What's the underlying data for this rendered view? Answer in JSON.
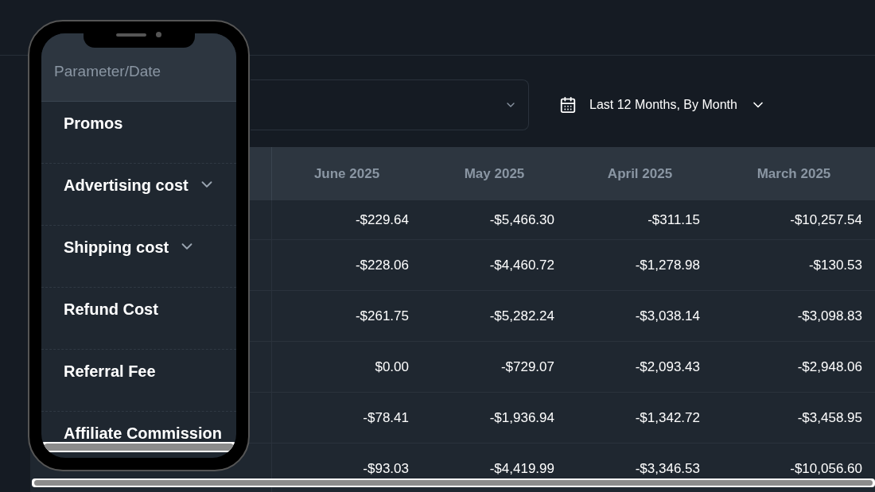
{
  "toolbar": {
    "date_range": {
      "label": "Last 12 Months, By Month"
    }
  },
  "table": {
    "columns": [
      "June 2025",
      "May 2025",
      "April 2025",
      "March 2025"
    ],
    "rows": [
      {
        "values": [
          "-$229.64",
          "-$5,466.30",
          "-$311.15",
          "-$10,257.54"
        ]
      },
      {
        "values": [
          "-$228.06",
          "-$4,460.72",
          "-$1,278.98",
          "-$130.53"
        ]
      },
      {
        "values": [
          "-$261.75",
          "-$5,282.24",
          "-$3,038.14",
          "-$3,098.83"
        ]
      },
      {
        "values": [
          "$0.00",
          "-$729.07",
          "-$2,093.43",
          "-$2,948.06"
        ]
      },
      {
        "values": [
          "-$78.41",
          "-$1,936.94",
          "-$1,342.72",
          "-$3,458.95"
        ]
      },
      {
        "values": [
          "-$93.03",
          "-$4,419.99",
          "-$3,346.53",
          "-$10,056.60"
        ]
      }
    ]
  },
  "phone": {
    "header": "Parameter/Date",
    "rows": [
      {
        "label": "Promos",
        "expandable": false
      },
      {
        "label": "Advertising cost",
        "expandable": true
      },
      {
        "label": "Shipping cost",
        "expandable": true
      },
      {
        "label": "Refund Cost",
        "expandable": false
      },
      {
        "label": "Referral Fee",
        "expandable": false
      },
      {
        "label": "Affiliate Commission",
        "expandable": false
      }
    ]
  }
}
